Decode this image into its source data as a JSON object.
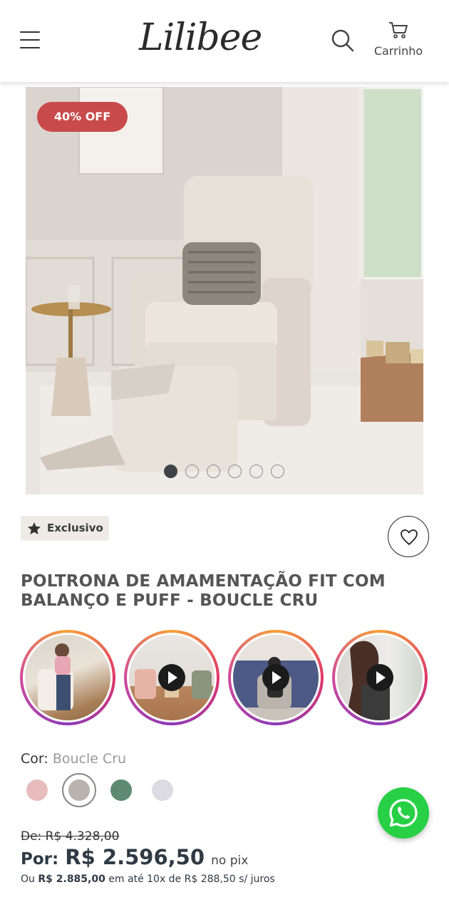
{
  "header": {
    "logo_text": "Lilibee",
    "cart_label": "Carrinho"
  },
  "product": {
    "discount_badge": "40% OFF",
    "image_count": 6,
    "active_image": 1,
    "badge_label": "Exclusivo",
    "title": "POLTRONA DE AMAMENTAÇÃO FIT COM BALANÇO E PUFF - BOUCLE CRU"
  },
  "stories": [
    {
      "has_play": false
    },
    {
      "has_play": true
    },
    {
      "has_play": true
    },
    {
      "has_play": true
    }
  ],
  "color": {
    "label": "Cor:",
    "selected": "Boucle Cru",
    "swatches": [
      "#e8bcbc",
      "#b9b2ae",
      "#5e8a71",
      "#dcdbe2"
    ]
  },
  "price": {
    "old": "De: R$ 4.328,00",
    "por_label": "Por:",
    "current": "R$ 2.596,50",
    "pix_label": "no pix",
    "installment_prefix": "Ou",
    "installment_total": "R$ 2.885,00",
    "installment_suffix": "em até 10x de R$ 288,50 s/ juros"
  },
  "colors": {
    "discount": "#c94a4a",
    "whatsapp": "#27d045",
    "price_text": "#2f3a44"
  }
}
